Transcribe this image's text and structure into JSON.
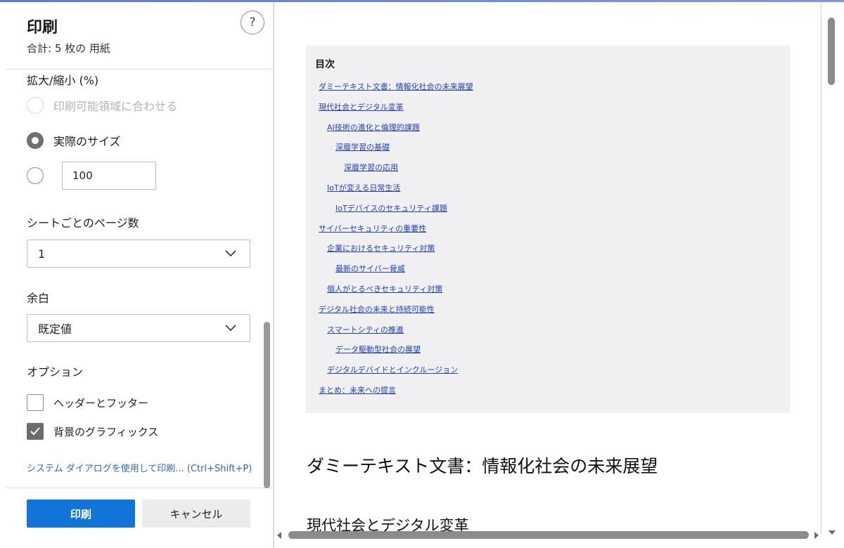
{
  "panel": {
    "title": "印刷",
    "subtitle": "合計: 5 枚の 用紙",
    "help_label": "?"
  },
  "scale": {
    "label": "拡大/縮小 (%)",
    "option_fit": "印刷可能領域に合わせる",
    "option_actual": "実際のサイズ",
    "custom_value": "100",
    "selected": "実際のサイズ"
  },
  "pages_per_sheet": {
    "label": "シートごとのページ数",
    "value": "1"
  },
  "margins": {
    "label": "余白",
    "value": "既定値"
  },
  "options": {
    "label": "オプション",
    "header_footer": "ヘッダーとフッター",
    "header_footer_checked": false,
    "background_graphics": "背景のグラフィックス",
    "background_graphics_checked": true
  },
  "system_dialog_link": "システム ダイアログを使用して印刷... (Ctrl+Shift+P)",
  "buttons": {
    "print": "印刷",
    "cancel": "キャンセル"
  },
  "preview": {
    "toc_title": "目次",
    "toc": [
      {
        "text": "ダミーテキスト文書：情報化社会の未来展望",
        "level": 0
      },
      {
        "text": "現代社会とデジタル変革",
        "level": 0
      },
      {
        "text": "AI技術の進化と倫理的課題",
        "level": 1
      },
      {
        "text": "深層学習の基礎",
        "level": 2
      },
      {
        "text": "深層学習の応用",
        "level": 3
      },
      {
        "text": "IoTが変える日常生活",
        "level": 1
      },
      {
        "text": "IoTデバイスのセキュリティ課題",
        "level": 2
      },
      {
        "text": "サイバーセキュリティの重要性",
        "level": 0
      },
      {
        "text": "企業におけるセキュリティ対策",
        "level": 1
      },
      {
        "text": "最新のサイバー脅威",
        "level": 2
      },
      {
        "text": "個人がとるべきセキュリティ対策",
        "level": 1
      },
      {
        "text": "デジタル社会の未来と持続可能性",
        "level": 0
      },
      {
        "text": "スマートシティの推進",
        "level": 1
      },
      {
        "text": "データ駆動型社会の展望",
        "level": 2
      },
      {
        "text": "デジタルデバイドとインクルージョン",
        "level": 1
      },
      {
        "text": "まとめ：未来への提言",
        "level": 0
      }
    ],
    "heading1": "ダミーテキスト文書：情報化社会の未来展望",
    "heading2": "現代社会とデジタル変革"
  }
}
